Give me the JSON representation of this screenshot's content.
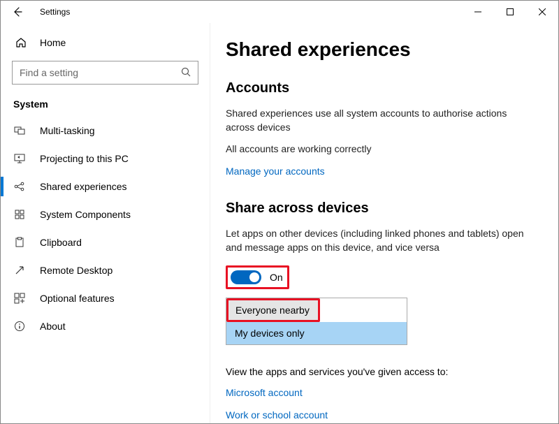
{
  "window": {
    "title": "Settings"
  },
  "sidebar": {
    "home": "Home",
    "search_placeholder": "Find a setting",
    "heading": "System",
    "items": [
      {
        "label": "Multi-tasking"
      },
      {
        "label": "Projecting to this PC"
      },
      {
        "label": "Shared experiences"
      },
      {
        "label": "System Components"
      },
      {
        "label": "Clipboard"
      },
      {
        "label": "Remote Desktop"
      },
      {
        "label": "Optional features"
      },
      {
        "label": "About"
      }
    ]
  },
  "main": {
    "title": "Shared experiences",
    "accounts": {
      "heading": "Accounts",
      "desc": "Shared experiences use all system accounts to authorise actions across devices",
      "status": "All accounts are working correctly",
      "manage_link": "Manage your accounts"
    },
    "share": {
      "heading": "Share across devices",
      "desc": "Let apps on other devices (including linked phones and tablets) open and message apps on this device, and vice versa",
      "toggle_label": "On",
      "options": {
        "a": "Everyone nearby",
        "b": "My devices only"
      },
      "view_text": "View the apps and services you've given access to:",
      "link1": "Microsoft account",
      "link2": "Work or school account"
    }
  }
}
